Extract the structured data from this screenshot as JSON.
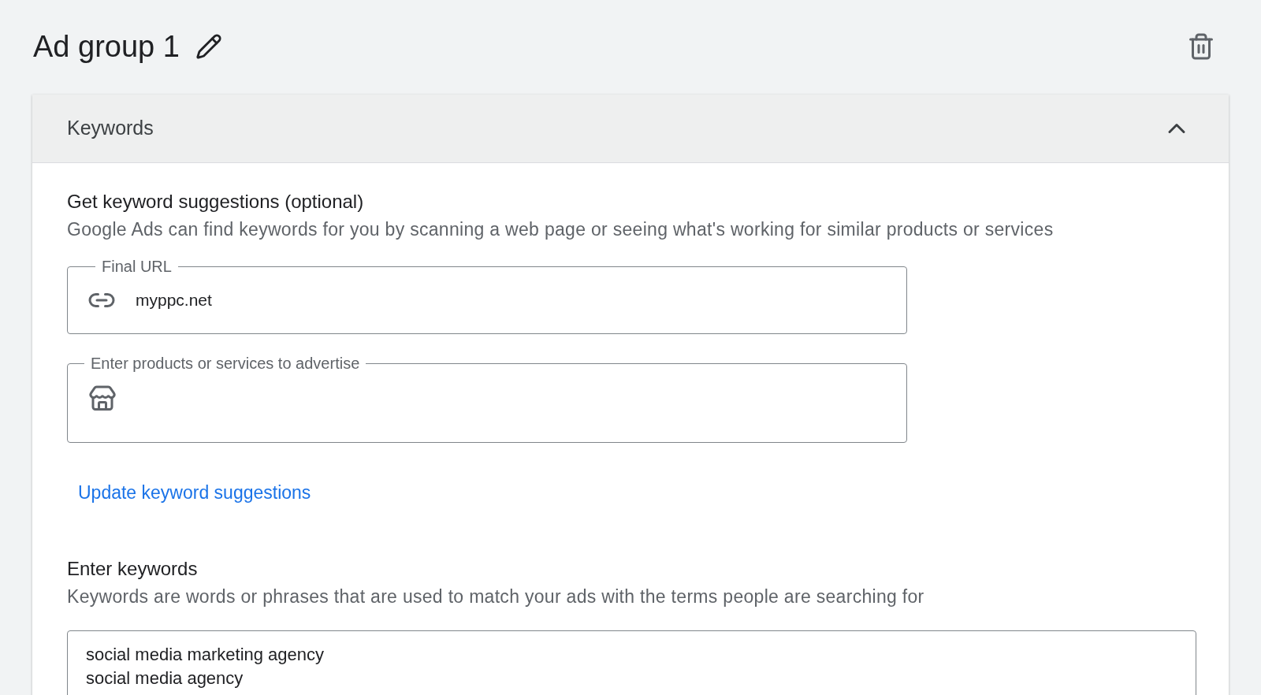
{
  "header": {
    "title": "Ad group 1"
  },
  "section": {
    "title": "Keywords",
    "expanded": true,
    "suggestions": {
      "heading": "Get keyword suggestions (optional)",
      "description": "Google Ads can find keywords for you by scanning a web page or seeing what's working for similar products or services",
      "url_field": {
        "label": "Final URL",
        "value": "myppc.net"
      },
      "products_field": {
        "label": "Enter products or services to advertise"
      },
      "update_link": "Update keyword suggestions"
    },
    "keywords": {
      "heading": "Enter keywords",
      "description": "Keywords are words or phrases that are used to match your ads with the terms people are searching for",
      "lines": [
        "social media marketing agency",
        "social media agency"
      ]
    }
  }
}
